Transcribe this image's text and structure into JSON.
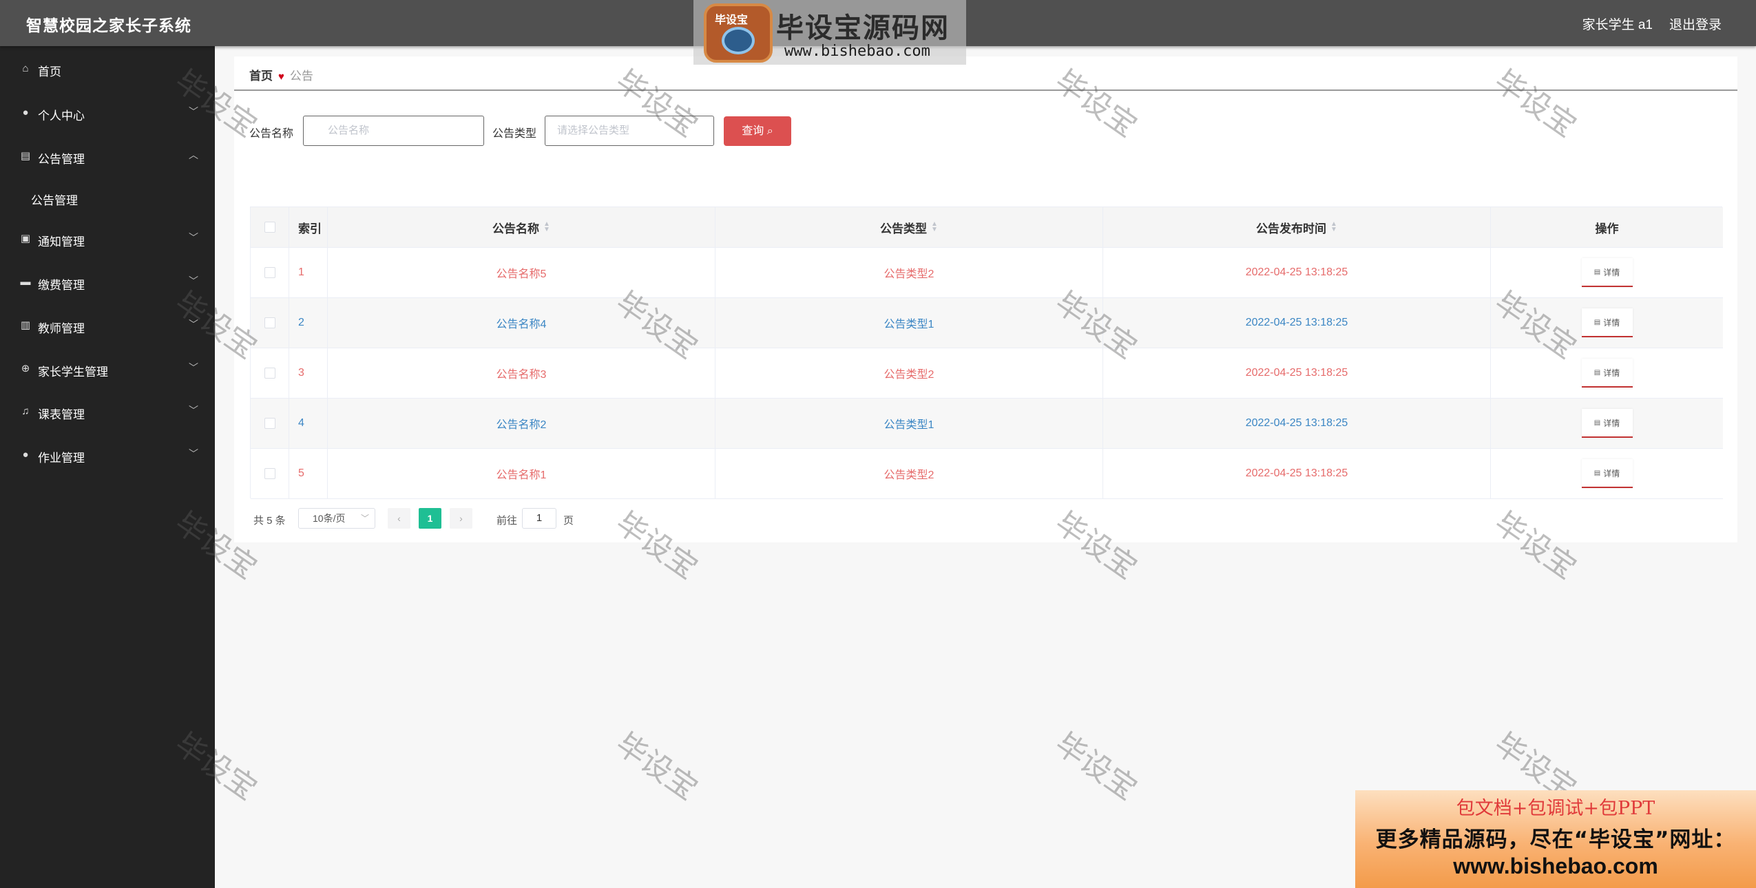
{
  "header": {
    "app_title": "智慧校园之家长子系统",
    "user_info": "家长学生 a1",
    "logout": "退出登录"
  },
  "logo": {
    "badge": "毕设宝",
    "main": "毕设宝源码网",
    "url": "www.bishebao.com"
  },
  "sidebar": {
    "items": [
      {
        "label": "首页",
        "icon": "home-icon"
      },
      {
        "label": "个人中心",
        "icon": "user-icon"
      },
      {
        "label": "公告管理",
        "icon": "briefcase-icon"
      },
      {
        "label": "公告管理",
        "icon": ""
      },
      {
        "label": "通知管理",
        "icon": "chart-icon"
      },
      {
        "label": "缴费管理",
        "icon": "chat-icon"
      },
      {
        "label": "教师管理",
        "icon": "clipboard-icon"
      },
      {
        "label": "家长学生管理",
        "icon": "target-icon"
      },
      {
        "label": "课表管理",
        "icon": "bell-icon"
      },
      {
        "label": "作业管理",
        "icon": "user-icon"
      }
    ]
  },
  "breadcrumb": {
    "home": "首页",
    "current": "公告"
  },
  "search": {
    "name_label": "公告名称",
    "name_placeholder": "公告名称",
    "type_label": "公告类型",
    "type_placeholder": "请选择公告类型",
    "button_label": "查询"
  },
  "table": {
    "columns": [
      "索引",
      "公告名称",
      "公告类型",
      "公告发布时间",
      "操作"
    ],
    "rows": [
      {
        "index": "1",
        "name": "公告名称5",
        "type": "公告类型2",
        "time": "2022-04-25 13:18:25",
        "action": "详情",
        "color": "#e66b6b"
      },
      {
        "index": "2",
        "name": "公告名称4",
        "type": "公告类型1",
        "time": "2022-04-25 13:18:25",
        "action": "详情",
        "color": "#3b86c4"
      },
      {
        "index": "3",
        "name": "公告名称3",
        "type": "公告类型2",
        "time": "2022-04-25 13:18:25",
        "action": "详情",
        "color": "#e66b6b"
      },
      {
        "index": "4",
        "name": "公告名称2",
        "type": "公告类型1",
        "time": "2022-04-25 13:18:25",
        "action": "详情",
        "color": "#3b86c4"
      },
      {
        "index": "5",
        "name": "公告名称1",
        "type": "公告类型2",
        "time": "2022-04-25 13:18:25",
        "action": "详情",
        "color": "#e66b6b"
      }
    ]
  },
  "pager": {
    "total": "共 5 条",
    "page_size": "10条/页",
    "current_page": "1",
    "goto_label": "前往",
    "goto_value": "1",
    "page_word": "页"
  },
  "watermark": "毕设宝",
  "promo": {
    "line1": "包文档+包调试+包PPT",
    "line2": "更多精品源码，尽在“毕设宝”网址：",
    "line3": "www.bishebao.com"
  }
}
